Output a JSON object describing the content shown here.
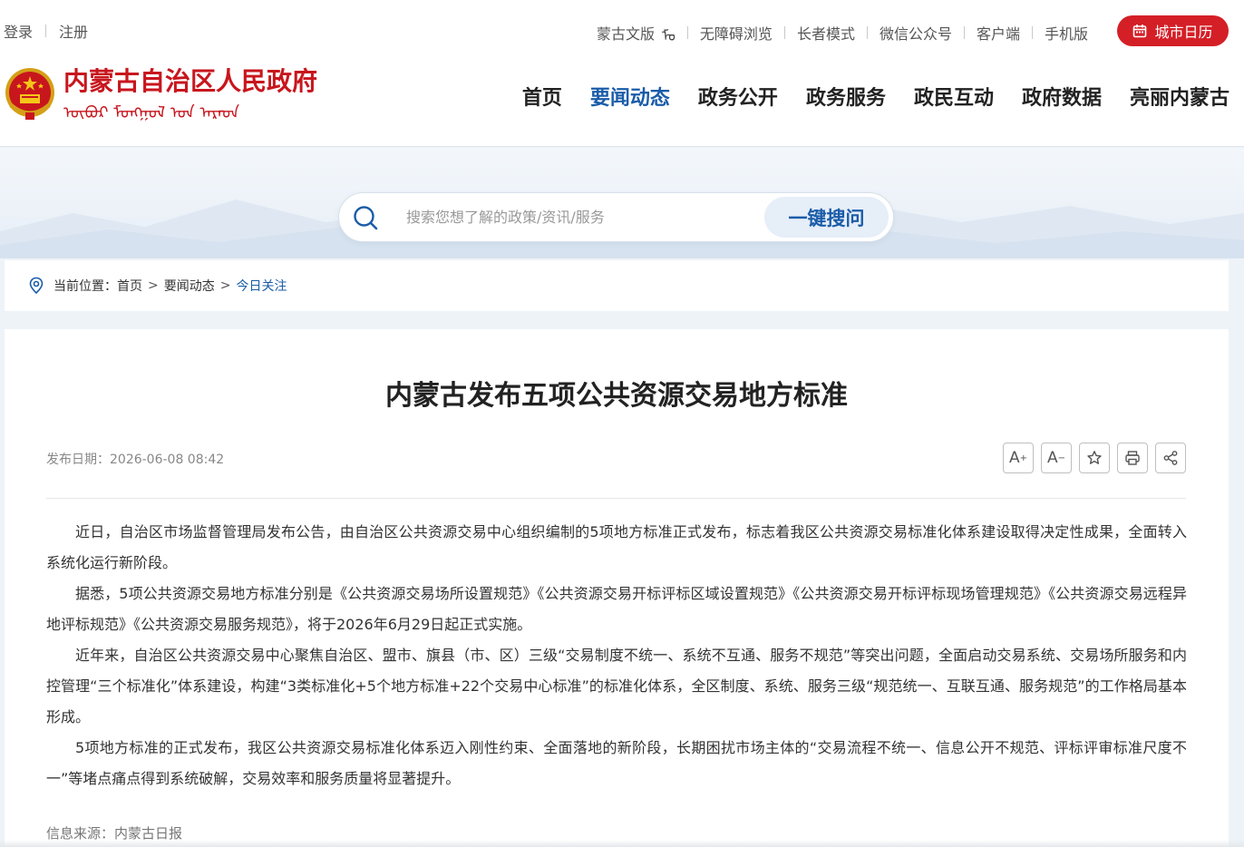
{
  "top_bar": {
    "login": "登录",
    "register": "注册",
    "links": [
      "蒙古文版",
      "无障碍浏览",
      "长者模式",
      "微信公众号",
      "客户端",
      "手机版"
    ],
    "mongolian_glyph": "ᠮᠣ",
    "calendar_button": "城市日历",
    "accent_color": "#d41f27"
  },
  "logo": {
    "title": "内蒙古自治区人民政府",
    "subtitle_mongolian": "ᠥᠪᠦᠷ ᠮᠣᠩᠭᠣᠯ ᠤᠨ ᠠᠷᠠᠳ"
  },
  "nav": {
    "items": [
      "首页",
      "要闻动态",
      "政务公开",
      "政务服务",
      "政民互动",
      "政府数据",
      "亮丽内蒙古"
    ],
    "active_index": 1,
    "active_color": "#1a5ca8"
  },
  "search": {
    "placeholder": "搜索您想了解的政策/资讯/服务",
    "button": "一键搜问"
  },
  "breadcrumb": {
    "label": "当前位置：",
    "items": [
      "首页",
      "要闻动态",
      "今日关注"
    ],
    "separator": ">"
  },
  "article": {
    "title": "内蒙古发布五项公共资源交易地方标准",
    "publish_date": "发布日期：2026-06-08 08:42",
    "tools": [
      "A+",
      "A-",
      "star-icon",
      "print-icon",
      "share-icon"
    ],
    "paragraphs": [
      "近日，自治区市场监督管理局发布公告，由自治区公共资源交易中心组织编制的5项地方标准正式发布，标志着我区公共资源交易标准化体系建设取得决定性成果，全面转入系统化运行新阶段。",
      "据悉，5项公共资源交易地方标准分别是《公共资源交易场所设置规范》《公共资源交易开标评标区域设置规范》《公共资源交易开标评标现场管理规范》《公共资源交易远程异地评标规范》《公共资源交易服务规范》，将于2026年6月29日起正式实施。",
      "近年来，自治区公共资源交易中心聚焦自治区、盟市、旗县（市、区）三级“交易制度不统一、系统不互通、服务不规范”等突出问题，全面启动交易系统、交易场所服务和内控管理“三个标准化”体系建设，构建“3类标准化+5个地方标准+22个交易中心标准”的标准化体系，全区制度、系统、服务三级“规范统一、互联互通、服务规范”的工作格局基本形成。",
      "5项地方标准的正式发布，我区公共资源交易标准化体系迈入刚性约束、全面落地的新阶段，长期困扰市场主体的“交易流程不统一、信息公开不规范、评标评审标准尺度不一”等堵点痛点得到系统破解，交易效率和服务质量将显著提升。"
    ],
    "source": "信息来源：内蒙古日报"
  }
}
